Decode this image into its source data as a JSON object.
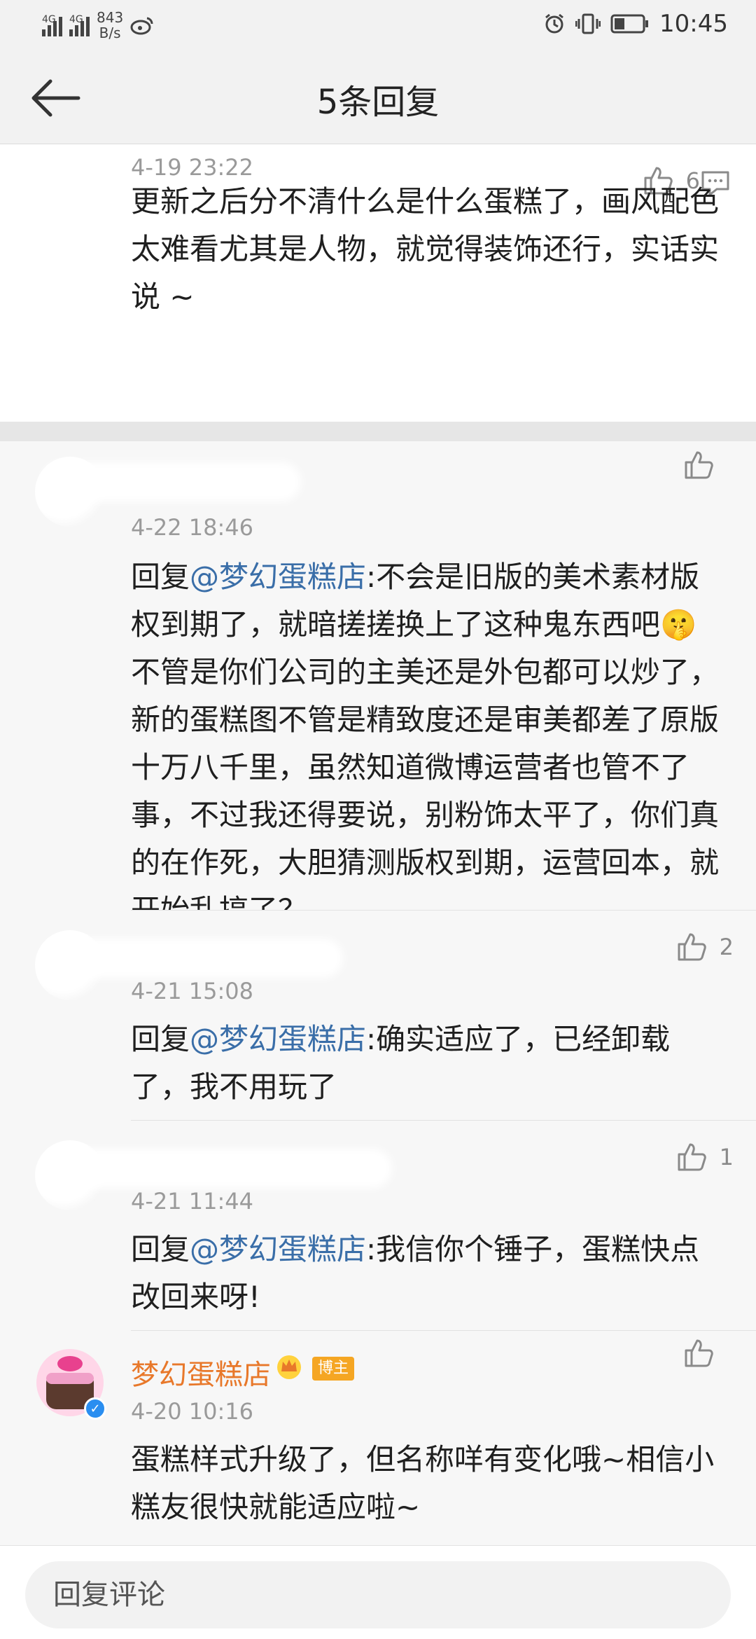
{
  "status_bar": {
    "signal1": "4G",
    "signal2": "4G",
    "net_speed_value": "843",
    "net_speed_unit": "B/s",
    "time": "10:45"
  },
  "header": {
    "title": "5条回复"
  },
  "main_comment": {
    "time": "4-19 23:22",
    "likes": "6",
    "text": "更新之后分不清什么是什么蛋糕了，画风配色太难看尤其是人物，就觉得装饰还行，实话实说 ~"
  },
  "replies": [
    {
      "time": "4-22 18:46",
      "likes": "",
      "prefix": "回复",
      "mention": "@梦幻蛋糕店",
      "body": ":不会是旧版的美术素材版权到期了，就暗搓搓换上了这种鬼东西吧🤫不管是你们公司的主美还是外包都可以炒了，新的蛋糕图不管是精致度还是审美都差了原版十万八千里，虽然知道微博运营者也管不了事，不过我还得要说，别粉饰太平了，你们真的在作死，大胆猜测版权到期，运营回本，就开始乱搞了？"
    },
    {
      "time": "4-21 15:08",
      "likes": "2",
      "prefix": "回复",
      "mention": "@梦幻蛋糕店",
      "body": ":确实适应了，已经卸载了，我不用玩了"
    },
    {
      "time": "4-21 11:44",
      "likes": "1",
      "prefix": "回复",
      "mention": "@梦幻蛋糕店",
      "body": ":我信你个锤子，蛋糕快点改回来呀!"
    },
    {
      "name": "梦幻蛋糕店",
      "badge": "博主",
      "time": "4-20 10:16",
      "likes": "",
      "body": "蛋糕样式升级了，但名称咩有变化哦~相信小糕友很快就能适应啦~"
    }
  ],
  "bottom": {
    "input_placeholder": "回复评论"
  },
  "colors": {
    "mention": "#3a6ea8",
    "owner_name": "#e8782a",
    "badge": "#f5a623",
    "verified": "#2a8ef0"
  }
}
